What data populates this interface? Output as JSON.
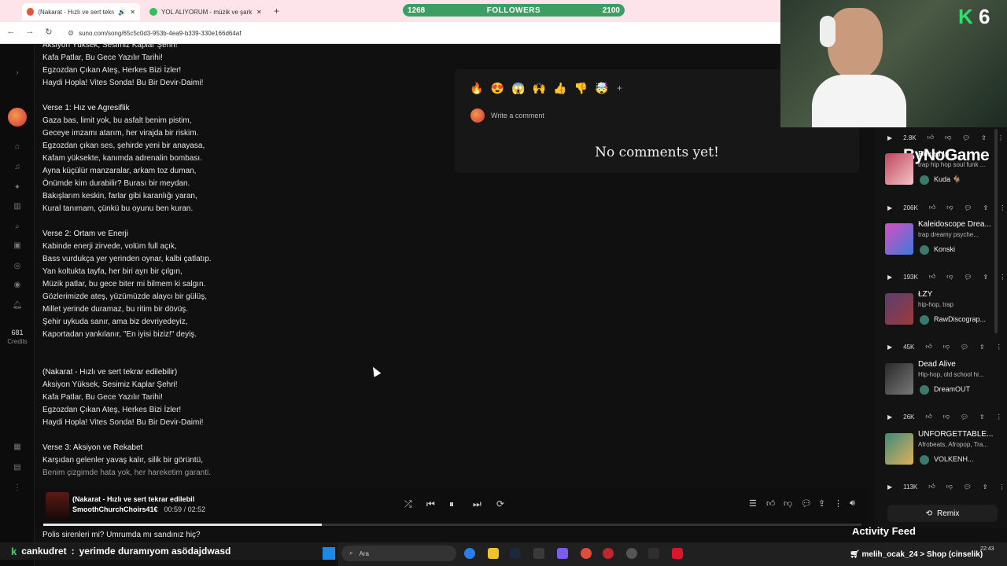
{
  "browser": {
    "tabs": [
      {
        "label": "(Nakarat - Hızlı ve sert tekrar"
      },
      {
        "label": "YOL ALIYORUM - müzik ve şark"
      }
    ],
    "url": "suno.com/song/65c5c0d3-953b-4ea9-b339-330e166d64af"
  },
  "followers": {
    "current": "1268",
    "label": "FOLLOWERS",
    "goal": "2100",
    "progress": 0.6
  },
  "credits": {
    "count": "681",
    "label": "Credits"
  },
  "lyrics": [
    "Aksiyon Yüksek, Sesimiz Kaplar Şehri!",
    "Kafa Patlar, Bu Gece Yazılır Tarihi!",
    "Egzozdan Çıkan Ateş, Herkes Bizi İzler!",
    "Haydi Hopla! Vites Sonda! Bu Bir Devir-Daimi!",
    "",
    "Verse 1: Hız ve Agresiflik",
    "Gaza bas, limit yok, bu asfalt benim pistim,",
    "Geceye imzamı atarım, her virajda bir riskim.",
    "Egzozdan çıkan ses, şehirde yeni bir anayasa,",
    "Kafam yüksekte, kanımda adrenalin bombası.",
    "Ayna küçülür manzaralar, arkam toz duman,",
    "Önümde kim durabilir? Burası bir meydan.",
    "Bakışlarım keskin, farlar gibi karanlığı yaran,",
    "Kural tanımam, çünkü bu oyunu ben kuran.",
    "",
    "Verse 2: Ortam ve Enerji",
    "Kabinde enerji zirvede, volüm full açık,",
    "Bass vurdukça yer yerinden oynar, kalbi çatlatıp.",
    "Yan koltukta tayfa, her biri ayrı bir çılgın,",
    "Müzik patlar, bu gece biter mi bilmem ki salgın.",
    "Gözlerimizde ateş, yüzümüzde alaycı bir gülüş,",
    "Millet yerinde duramaz, bu ritim bir dövüş.",
    "Şehir uykuda sanır, ama biz devriyedeyiz,",
    "Kaportadan yankılanır, \"En iyisi biziz!\" deyiş.",
    "",
    "",
    "(Nakarat - Hızlı ve sert tekrar edilebilir)",
    "Aksiyon Yüksek, Sesimiz Kaplar Şehri!",
    "Kafa Patlar, Bu Gece Yazılır Tarihi!",
    "Egzozdan Çıkan Ateş, Herkes Bizi İzler!",
    "Haydi Hopla! Vites Sonda! Bu Bir Devir-Daimi!",
    "",
    "Verse 3: Aksiyon ve Rekabet",
    "Karşıdan gelenler yavaş kalır, silik bir görüntü,",
    "Benim çizgimde hata yok, her hareketim garanti."
  ],
  "last_line": "Polis sirenleri mi? Umrumda mı sandınız hiç?",
  "comments": {
    "reactions": [
      "🔥",
      "😍",
      "😱",
      "🙌",
      "👍",
      "👎",
      "🤯"
    ],
    "add_reaction": "+",
    "placeholder": "Write a comment",
    "empty": "No comments yet!"
  },
  "overlay": {
    "brand": "ByNoGame",
    "k_badge": "K",
    "k_number": "6"
  },
  "songs": [
    {
      "title": "Boxed In",
      "tags": "trap hip hop soul funk ...",
      "artist": "Kuda 🐐",
      "plays": "2.8K",
      "color1": "#c0465a",
      "color2": "#f3c3c8"
    },
    {
      "title": "Kaleidoscope Drea...",
      "tags": "trap dreamy psyche...",
      "artist": "Konski",
      "plays": "206K",
      "color1": "#d94ec3",
      "color2": "#3b7bd8"
    },
    {
      "title": "ŁZY",
      "tags": "hip-hop, trap",
      "artist": "RawDiscograp...",
      "plays": "193K",
      "color1": "#5a3e6e",
      "color2": "#9c3b3b"
    },
    {
      "title": "Dead Alive",
      "tags": "Hip-hop, old school hi...",
      "artist": "DreamOUT",
      "plays": "45K",
      "color1": "#2a2a2a",
      "color2": "#777777"
    },
    {
      "title": "UNFORGETTABLE...",
      "tags": "Afrobeats, Afropop, Tra...",
      "artist": "VOLKENH...",
      "plays": "26K",
      "color1": "#3e8a7a",
      "color2": "#e0b058"
    }
  ],
  "last_plays": "113K",
  "remix_label": "Remix",
  "activity_feed": "Activity Feed",
  "player": {
    "title": "(Nakarat - Hızlı ve sert tekrar edilebil",
    "artist": "SmoothChurchChoirs41€",
    "elapsed": "00:59",
    "separator": "/",
    "duration": "02:52",
    "progress": 0.34
  },
  "chat": {
    "user": "cankudret",
    "separator": ":",
    "message": "yerimde duramıyom asödajdwasd"
  },
  "taskbar": {
    "search": "Ara",
    "ticker": "melih_ocak_24 > Shop (cinselik)",
    "time": "22:43"
  }
}
